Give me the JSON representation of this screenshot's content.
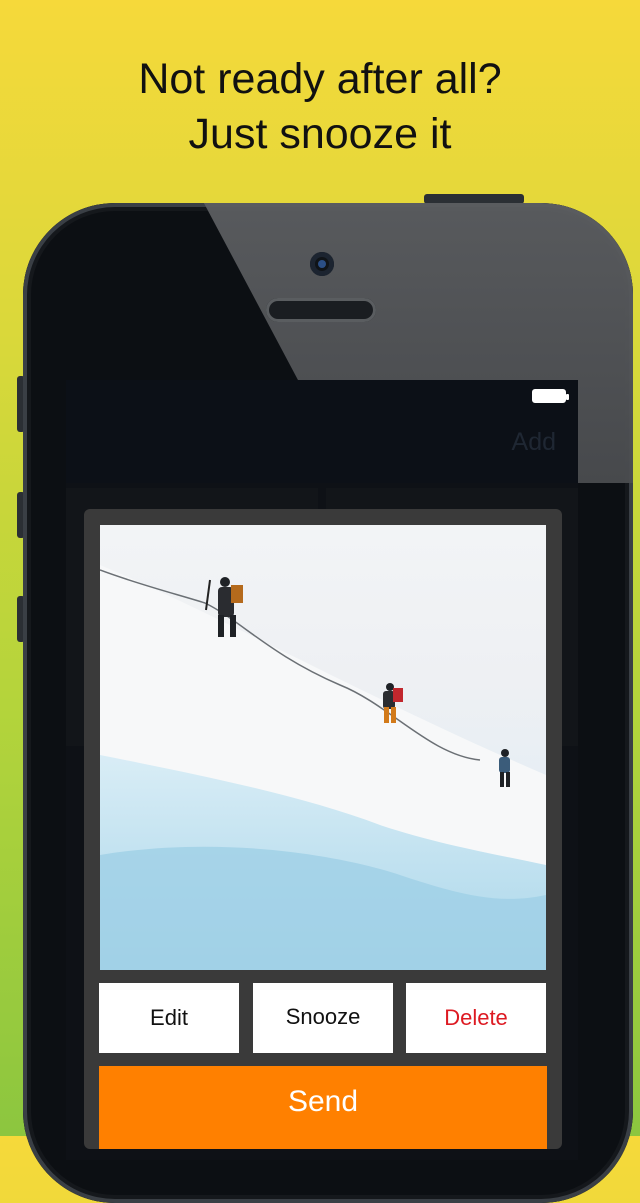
{
  "promo": {
    "line1": "Not ready after all?",
    "line2": "Just snooze it"
  },
  "app": {
    "nav_add_label": "Add",
    "actions": {
      "edit": "Edit",
      "snooze": "Snooze",
      "delete": "Delete"
    },
    "send_label": "Send"
  },
  "colors": {
    "send": "#ff8000",
    "delete_text": "#dd1a22",
    "modal_bg": "#3a3a3a"
  },
  "icons": [
    "battery-icon"
  ]
}
